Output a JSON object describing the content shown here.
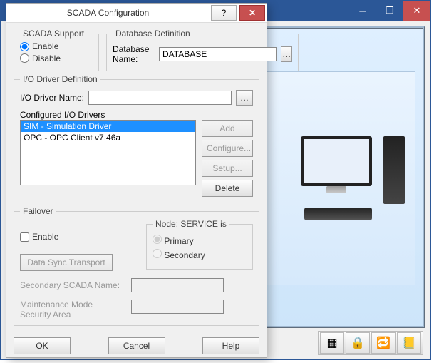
{
  "parent_window": {
    "controls": {
      "minimize": "─",
      "restore": "❐",
      "close": "✕"
    },
    "toolbar_icons": [
      "grid-icon",
      "lock-icon",
      "refresh-icon",
      "alarm-icon"
    ]
  },
  "dialog": {
    "title": "SCADA Configuration",
    "help_glyph": "?",
    "close_glyph": "✕",
    "scada_support": {
      "legend": "SCADA Support",
      "enable": "Enable",
      "disable": "Disable",
      "selected": "enable"
    },
    "db_def": {
      "legend": "Database Definition",
      "name_label": "Database Name:",
      "name_value": "DATABASE"
    },
    "io_driver": {
      "legend": "I/O Driver Definition",
      "name_label": "I/O Driver Name:",
      "name_value": "",
      "configured_label": "Configured I/O Drivers",
      "drivers": [
        {
          "label": "SIM - Simulation Driver",
          "selected": true
        },
        {
          "label": "OPC - OPC Client v7.46a",
          "selected": false
        }
      ],
      "buttons": {
        "add": "Add",
        "configure": "Configure...",
        "setup": "Setup...",
        "delete": "Delete"
      }
    },
    "failover": {
      "legend": "Failover",
      "enable": "Enable",
      "transport_btn": "Data Sync Transport",
      "node_label": "Node: SERVICE is",
      "primary": "Primary",
      "secondary": "Secondary",
      "secondary_name_label": "Secondary SCADA Name:",
      "secondary_name_value": "",
      "maint_label_l1": "Maintenance Mode",
      "maint_label_l2": "Security Area",
      "maint_value": ""
    },
    "footer": {
      "ok": "OK",
      "cancel": "Cancel",
      "help": "Help"
    }
  }
}
